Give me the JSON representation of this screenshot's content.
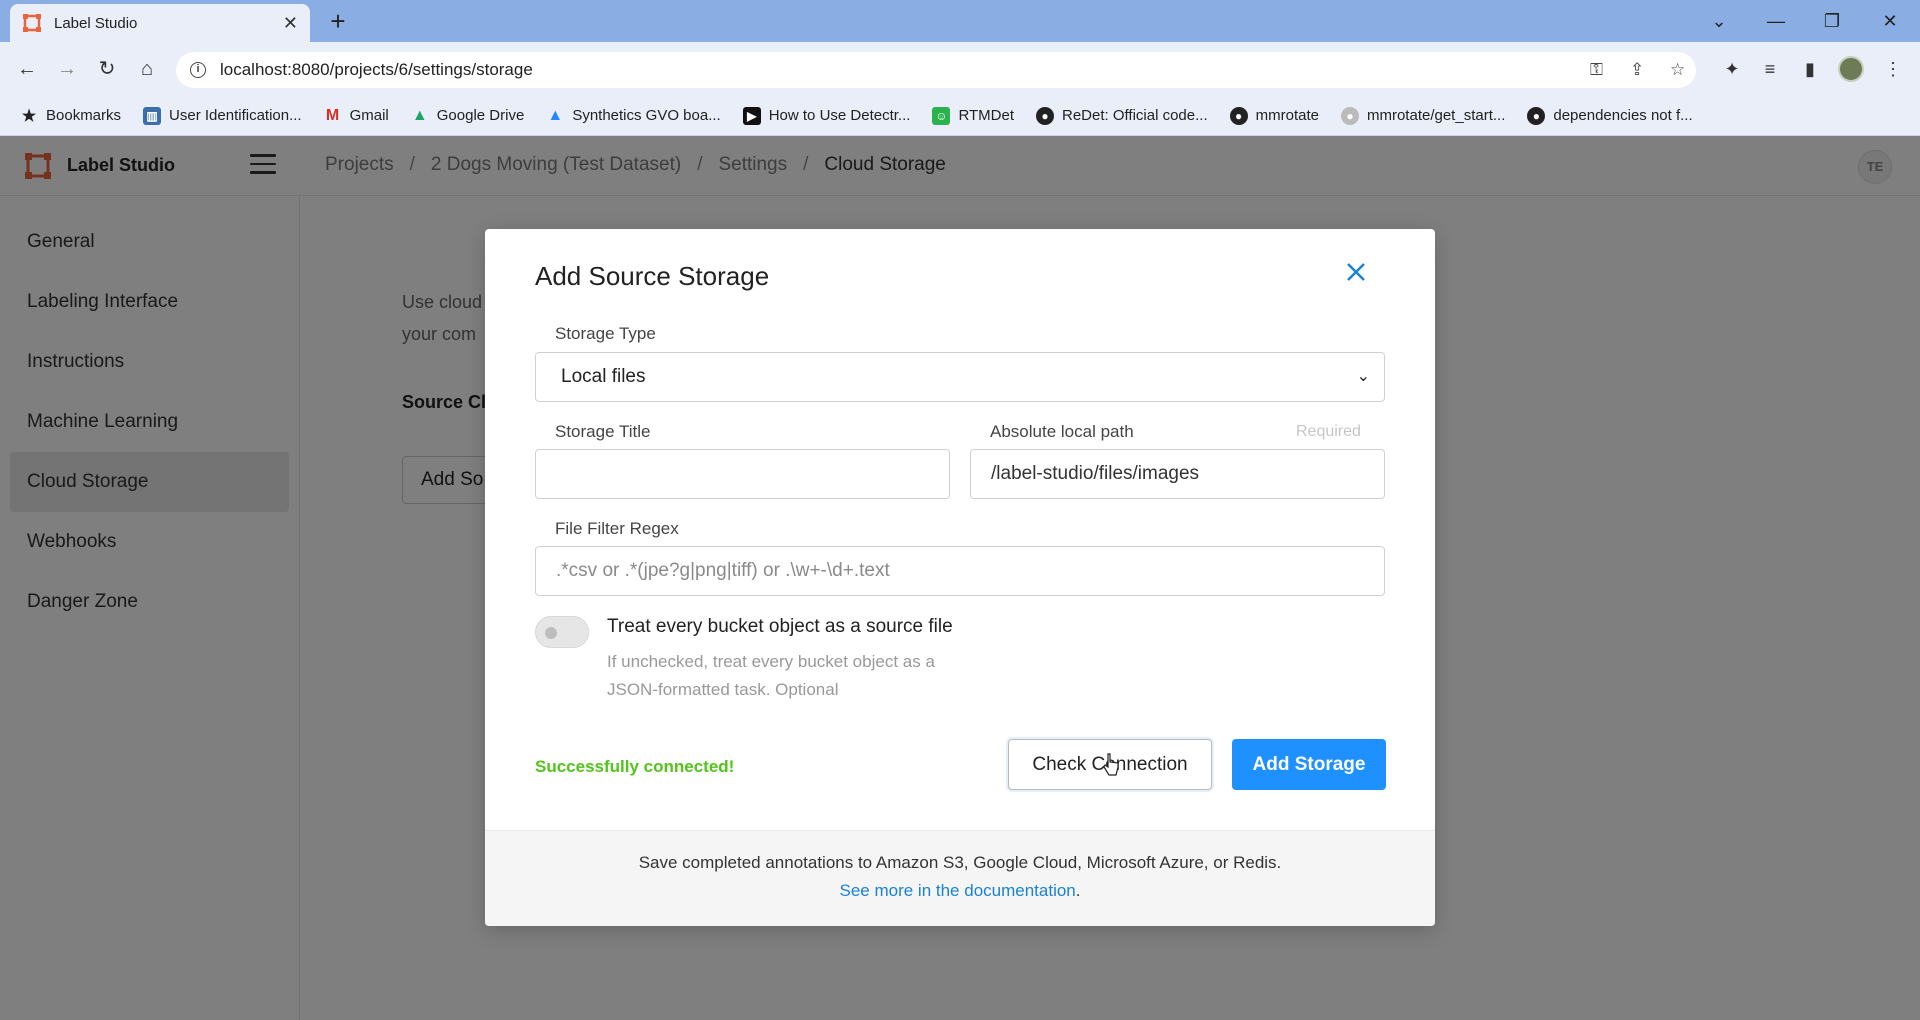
{
  "browser": {
    "tab_title": "Label Studio",
    "url": "localhost:8080/projects/6/settings/storage",
    "bookmarks": [
      {
        "label": "Bookmarks",
        "icon": "star-icon"
      },
      {
        "label": "User Identification...",
        "icon": "chart-icon"
      },
      {
        "label": "Gmail",
        "icon": "gmail-icon"
      },
      {
        "label": "Google Drive",
        "icon": "drive-icon"
      },
      {
        "label": "Synthetics GVO boa...",
        "icon": "atlassian-icon"
      },
      {
        "label": "How to Use Detectr...",
        "icon": "video-icon"
      },
      {
        "label": "RTMDet",
        "icon": "smiley-icon"
      },
      {
        "label": "ReDet: Official code...",
        "icon": "github-icon"
      },
      {
        "label": "mmrotate",
        "icon": "github-icon"
      },
      {
        "label": "mmrotate/get_start...",
        "icon": "github-icon"
      },
      {
        "label": "dependencies not f...",
        "icon": "github-icon"
      }
    ]
  },
  "app": {
    "name": "Label Studio",
    "user_initials": "TE",
    "breadcrumb": [
      "Projects",
      "2 Dogs Moving (Test Dataset)",
      "Settings",
      "Cloud Storage"
    ],
    "sidebar": [
      "General",
      "Labeling Interface",
      "Instructions",
      "Machine Learning",
      "Cloud Storage",
      "Webhooks",
      "Danger Zone"
    ],
    "sidebar_active": "Cloud Storage",
    "background": {
      "line1": "Use cloud",
      "line2": "your com",
      "source_label": "Source Cl",
      "add_source_button": "Add So"
    }
  },
  "modal": {
    "title": "Add Source Storage",
    "storage_type_label": "Storage Type",
    "storage_type_value": "Local files",
    "storage_title_label": "Storage Title",
    "storage_title_value": "",
    "path_label": "Absolute local path",
    "path_required": "Required",
    "path_value": "/label-studio/files/images",
    "regex_label": "File Filter Regex",
    "regex_placeholder": ".*csv or .*(jpe?g|png|tiff) or .\\w+-\\d+.text",
    "toggle_label": "Treat every bucket object as a source file",
    "toggle_hint": "If unchecked, treat every bucket object as a JSON-formatted task. Optional",
    "toggle_on": false,
    "status_message": "Successfully connected!",
    "check_button": "Check Connection",
    "add_button": "Add Storage",
    "footer_text": "Save completed annotations to Amazon S3, Google Cloud, Microsoft Azure, or Redis.",
    "footer_link": "See more in the documentation",
    "footer_link_suffix": "."
  },
  "colors": {
    "accent": "#1e90ff",
    "success": "#52c41a",
    "link": "#1a82d6",
    "tabbar": "#8aaee4"
  }
}
